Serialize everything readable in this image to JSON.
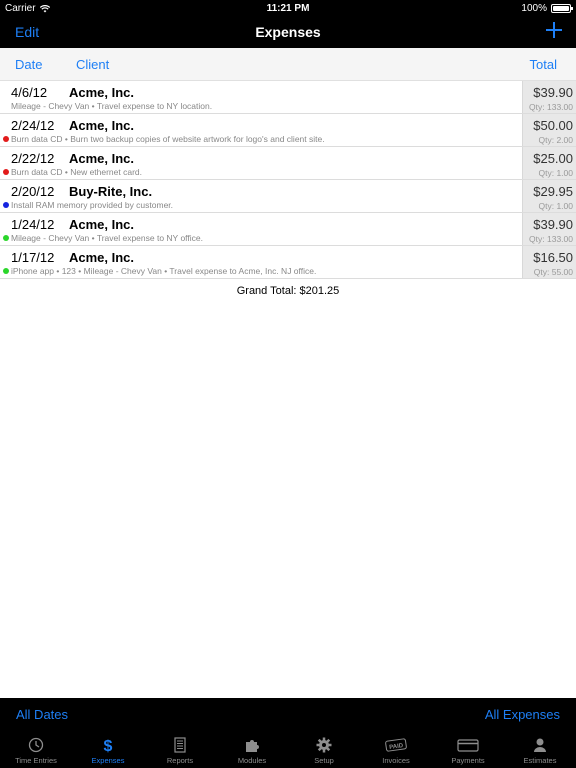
{
  "status_bar": {
    "carrier": "Carrier",
    "time": "11:21 PM",
    "battery": "100%"
  },
  "nav": {
    "edit_label": "Edit",
    "title": "Expenses"
  },
  "sort_header": {
    "date_label": "Date",
    "client_label": "Client",
    "total_label": "Total"
  },
  "expenses": [
    {
      "date": "4/6/12",
      "client": "Acme, Inc.",
      "description": "Mileage - Chevy Van • Travel expense to NY location.",
      "amount": "$39.90",
      "qty": "Qty: 133.00",
      "dot": ""
    },
    {
      "date": "2/24/12",
      "client": "Acme, Inc.",
      "description": "Burn data CD • Burn two backup copies of website artwork for logo's and client site.",
      "amount": "$50.00",
      "qty": "Qty: 2.00",
      "dot": "#e21b1b"
    },
    {
      "date": "2/22/12",
      "client": "Acme, Inc.",
      "description": "Burn data CD • New ethernet card.",
      "amount": "$25.00",
      "qty": "Qty: 1.00",
      "dot": "#e21b1b"
    },
    {
      "date": "2/20/12",
      "client": "Buy-Rite, Inc.",
      "description": "Install RAM memory provided by customer.",
      "amount": "$29.95",
      "qty": "Qty: 1.00",
      "dot": "#1624e0"
    },
    {
      "date": "1/24/12",
      "client": "Acme, Inc.",
      "description": "Mileage - Chevy Van • Travel expense to NY office.",
      "amount": "$39.90",
      "qty": "Qty: 133.00",
      "dot": "#2bd62b"
    },
    {
      "date": "1/17/12",
      "client": "Acme, Inc.",
      "description": "iPhone app • 123 • Mileage - Chevy Van • Travel expense to Acme, Inc. NJ office.",
      "amount": "$16.50",
      "qty": "Qty: 55.00",
      "dot": "#2bd62b"
    }
  ],
  "grand_total": "Grand Total: $201.25",
  "filter_bar": {
    "dates_label": "All Dates",
    "expenses_label": "All Expenses"
  },
  "tabs": [
    {
      "label": "Time Entries",
      "icon": "clock-icon"
    },
    {
      "label": "Expenses",
      "icon": "dollar-icon",
      "active": true
    },
    {
      "label": "Reports",
      "icon": "report-icon"
    },
    {
      "label": "Modules",
      "icon": "puzzle-icon"
    },
    {
      "label": "Setup",
      "icon": "gear-icon"
    },
    {
      "label": "Invoices",
      "icon": "paid-stamp-icon"
    },
    {
      "label": "Payments",
      "icon": "credit-card-icon"
    },
    {
      "label": "Estimates",
      "icon": "person-icon"
    }
  ],
  "colors": {
    "accent": "#1e7ff5",
    "bar_background": "#000000",
    "amount_cell": "#e8e8e8"
  }
}
